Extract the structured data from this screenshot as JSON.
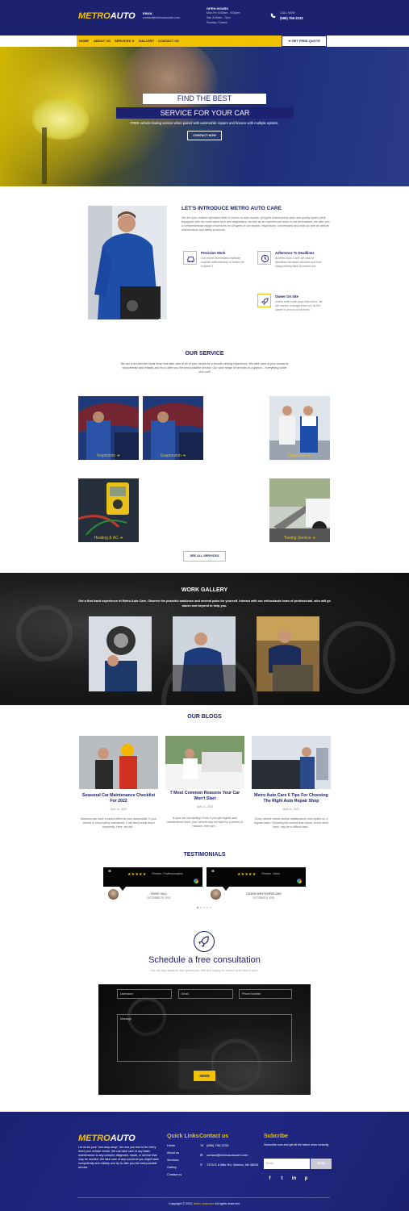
{
  "header": {
    "logo_main": "METRO",
    "logo_accent": "AUTO",
    "email_label": "EMAIL",
    "email_value": "contact@metroautocare.com",
    "hours_label": "OPEN HOURS",
    "hours_line1": "Mon-Fri: 8:00am - 6:00pm",
    "hours_line2": "Sat: 8:00am - 3pm",
    "hours_line3": "Sunday: Closed",
    "call_label": "CALL NOW",
    "call_value": "(586) 756-2233"
  },
  "nav": {
    "items": [
      "HOME",
      "ABOUT US",
      "SERVICES",
      "GALLERY",
      "CONTACT US"
    ],
    "quote": "GET FREE QUOTE"
  },
  "hero": {
    "title1": "FIND THE BEST",
    "title2": "SERVICE FOR YOUR CAR",
    "subtitle": "FREE vehicle towing service when paired with automobile repairs and finance with multiple options.",
    "button": "CONTACT NOW"
  },
  "intro": {
    "title": "LET'S INTRODUCE METRO AUTO CARE",
    "text": "We are your reliable specialist when it comes to auto repairs, all types maintenance work and quality spare parts. Equipped with the most latest tech and diagnostics, as well as an experienced team of car technicians, we offer you a comprehensive range of services for all types of car repairs, inspections, conversions and tests as well as vehicle maintenance and safety protocols.",
    "features": [
      {
        "title": "Precision Work",
        "text": "Our expert technicians replicate original craftsmanship or better yet surpass it."
      },
      {
        "title": "Adherence To Deadlines",
        "text": "At Metro Auto Care, we stick to deadlines because we know just how disappointing false promises are."
      },
      {
        "title": "Owner On Site",
        "text": "Unlike multi chain auto franchises, we are owned, managed and run by the owner in person at all times."
      }
    ]
  },
  "services": {
    "title": "OUR SERVICE",
    "desc": "We are a full-service repair shop that take care of all of your needs for a smooth driving experience. We take care of your concerns competently and reliably and try to offer you the best possible service. Our wide range of services at a glance – everything under one roof!",
    "items": [
      "Inspection",
      "Suspension",
      "Upgrades",
      "Heating & AC",
      "Towing Service"
    ],
    "see_all": "SEE ALL SERVICES"
  },
  "gallery": {
    "title": "WORK GALLERY",
    "subtitle": "Get a first hand experience of Metro Auto Care. Observe the peaceful ambience and several pairs for yourself. Interact with our enthusiastic team of professional, who will go above and beyond to help you."
  },
  "blogs": {
    "title": "OUR BLOGS",
    "posts": [
      {
        "title": "Seasonal Car Maintenance Checklist For 2022",
        "date": "April 14, 2022",
        "text": "Seasons can have a varied effect on your automobile. If your vehicle is not properly maintained, it will likely break down frequently. Here, we will..."
      },
      {
        "title": "7 Most Common Reasons Your Car Won't Start",
        "date": "April 14, 2022",
        "text": "Is your car not starting? Even if you get regular auto maintenance done, your vehicle may not start for a variety of reasons. Here are..."
      },
      {
        "title": "Metro Auto Care 6 Tips For Choosing The Right Auto Repair Shop",
        "date": "April 14, 2022",
        "text": "Every vehicle needs routine maintenance and repairs on a regular basis. Choosing the correct auto repair, on the other hand, may be a difficult task..."
      }
    ]
  },
  "testimonials": {
    "title": "TESTIMONIALS",
    "items": [
      {
        "quote_mark": "“",
        "stars": "★★★★★",
        "text": "Positive: Professionalism",
        "name": "EDDIE HALL",
        "date": "OCTOBER 29, 2021"
      },
      {
        "quote_mark": "“",
        "stars": "★★★★★",
        "text": "Positive: Value",
        "name": "CEARA WESTMORELAND",
        "date": "OCTOBER 5, 2021"
      }
    ]
  },
  "schedule": {
    "title": "Schedule a free consultation",
    "subtitle": "Do not shy away to ask questions. We are happy to advise and inform you!",
    "name_placeholder": "Username",
    "email_placeholder": "Email",
    "phone_placeholder": "Phone Number",
    "message_placeholder": "Message",
    "send": "SEND"
  },
  "footer": {
    "about": "Let us be your \"one-stop-shop\", the one you turn to for every need your vehicle needs. We can take care of any basic maintenance to any complex diagnosis, repair, or service that may be needed. We take care of any concerns you might have competently and reliably and try to offer you the best possible service.",
    "quick_links_title": "Quick Links",
    "quick_links": [
      "Home",
      "About us",
      "Services",
      "Gallery",
      "Contact us"
    ],
    "contact_title": "Contact us",
    "phone": "(586) 756-2233",
    "email": "contact@metroautocare.com",
    "address": "7575 E 8 Mile Rd, Warren, MI 48091",
    "subscribe_title": "Subcribe",
    "subscribe_text": "Subscribe now and get all the latest news instantly",
    "subscribe_placeholder": "Email",
    "subscribe_button": "SEND",
    "social": [
      "f",
      "t",
      "in",
      "p"
    ],
    "copyright_prefix": "Copyright © 2021",
    "copyright_brand": "Metro Autocare",
    "copyright_suffix": "All rights reserved."
  },
  "colors": {
    "navy": "#1c2170",
    "yellow": "#f2c200"
  }
}
